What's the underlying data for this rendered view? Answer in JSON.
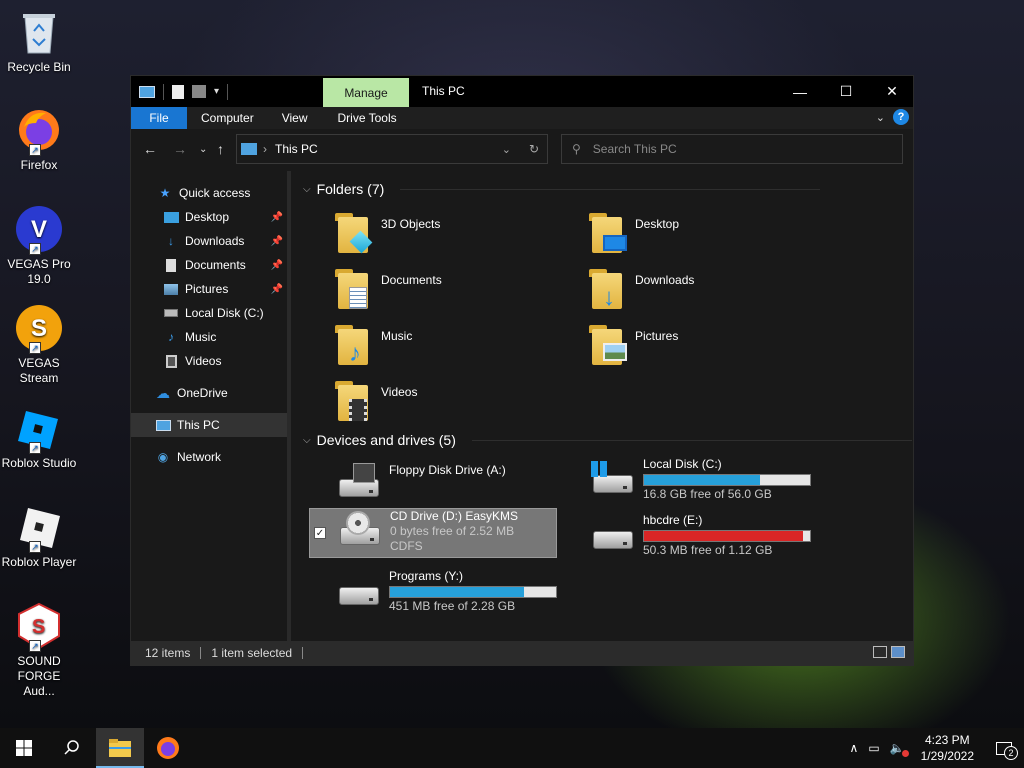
{
  "desktop": {
    "icons": [
      {
        "label": "Recycle Bin"
      },
      {
        "label": "Firefox"
      },
      {
        "label": "VEGAS Pro 19.0"
      },
      {
        "label": "VEGAS Stream"
      },
      {
        "label": "Roblox Studio"
      },
      {
        "label": "Roblox Player"
      },
      {
        "label": "SOUND FORGE Aud..."
      }
    ]
  },
  "window": {
    "title": "This PC",
    "manage_tab": "Manage",
    "ribbon_tabs": {
      "file": "File",
      "computer": "Computer",
      "view": "View",
      "drive_tools": "Drive Tools"
    },
    "address": "This PC",
    "search_placeholder": "Search This PC",
    "nav": {
      "quick_access": "Quick access",
      "desktop": "Desktop",
      "downloads": "Downloads",
      "documents": "Documents",
      "pictures": "Pictures",
      "local_disk": "Local Disk (C:)",
      "music": "Music",
      "videos": "Videos",
      "onedrive": "OneDrive",
      "this_pc": "This PC",
      "network": "Network"
    },
    "folders_header": "Folders (7)",
    "folders": {
      "objects3d": "3D Objects",
      "desktop": "Desktop",
      "documents": "Documents",
      "downloads": "Downloads",
      "music": "Music",
      "pictures": "Pictures",
      "videos": "Videos"
    },
    "devices_header": "Devices and drives (5)",
    "drives": {
      "floppy": {
        "name": "Floppy Disk Drive (A:)"
      },
      "local_c": {
        "name": "Local Disk (C:)",
        "free": "16.8 GB free of 56.0 GB",
        "used_fraction": 0.7
      },
      "cd": {
        "name": "CD Drive (D:) EasyKMS",
        "free": "0 bytes free of 2.52 MB",
        "fs": "CDFS"
      },
      "hbcdre": {
        "name": "hbcdre (E:)",
        "free": "50.3 MB free of 1.12 GB",
        "used_fraction": 0.96
      },
      "programs": {
        "name": "Programs (Y:)",
        "free": "451 MB free of 2.28 GB",
        "used_fraction": 0.81
      }
    },
    "status": {
      "items": "12 items",
      "selected": "1 item selected"
    }
  },
  "taskbar": {
    "time": "4:23 PM",
    "date": "1/29/2022",
    "notification_count": "2"
  },
  "colors": {
    "accent": "#1976d2",
    "bar_blue": "#26a0da",
    "bar_red": "#da2626",
    "manage": "#b9e7a5"
  }
}
